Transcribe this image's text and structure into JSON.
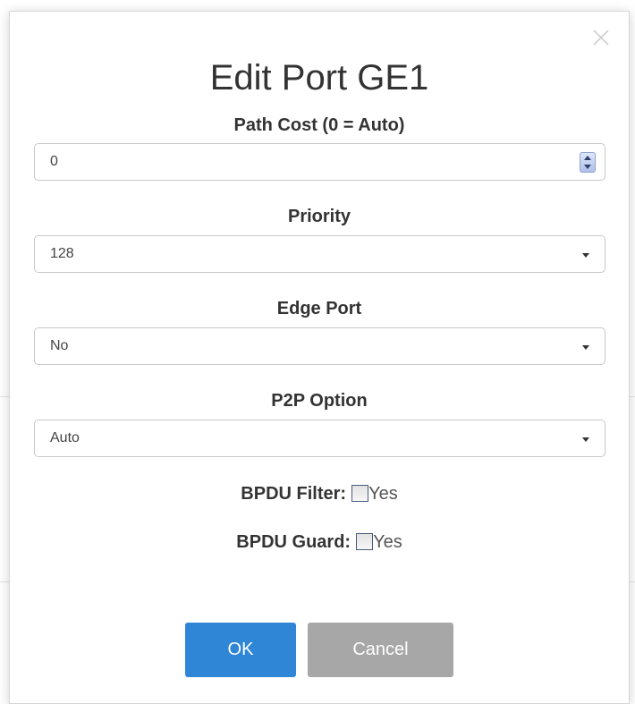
{
  "dialog": {
    "title": "Edit Port GE1",
    "close_icon": "close-icon"
  },
  "fields": {
    "path_cost": {
      "label": "Path Cost (0 = Auto)",
      "value": "0"
    },
    "priority": {
      "label": "Priority",
      "value": "128"
    },
    "edge_port": {
      "label": "Edge Port",
      "value": "No"
    },
    "p2p_option": {
      "label": "P2P Option",
      "value": "Auto"
    }
  },
  "checkboxes": {
    "bpdu_filter": {
      "label": "BPDU Filter:",
      "option": "Yes",
      "checked": false
    },
    "bpdu_guard": {
      "label": "BPDU Guard:",
      "option": "Yes",
      "checked": false
    }
  },
  "buttons": {
    "ok_label": "OK",
    "cancel_label": "Cancel"
  },
  "colors": {
    "ok": "#2f86d6",
    "cancel": "#a7a7a7"
  }
}
